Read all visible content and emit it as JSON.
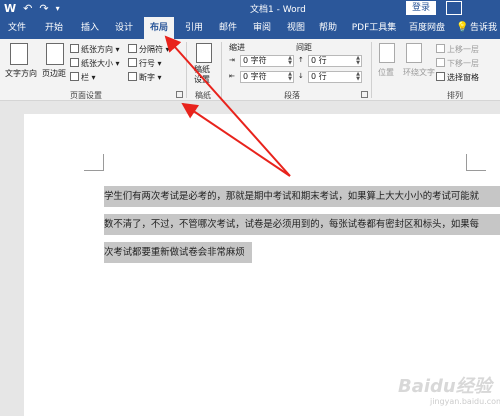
{
  "titlebar": {
    "title": "文档1 - Word",
    "login": "登录",
    "qat": [
      "W",
      "↶",
      "↷",
      "▾"
    ]
  },
  "tabs": [
    "文件",
    "开始",
    "插入",
    "设计",
    "布局",
    "引用",
    "邮件",
    "审阅",
    "视图",
    "帮助",
    "PDF工具集",
    "百度网盘",
    "操作说明搜索",
    "告诉我"
  ],
  "ribbon": {
    "text_direction": "文字方向",
    "margins": "页边距",
    "orientation": "纸张方向",
    "size": "纸张大小",
    "columns": "栏",
    "breaks": "分隔符",
    "line_numbers": "行号",
    "hyphenation": "断字",
    "group_page_setup": "页面设置",
    "manuscript": "稿纸\n设置",
    "group_manuscript": "稿纸",
    "indent": "缩进",
    "spacing": "间距",
    "indent_left": "0 字符",
    "indent_right": "0 字符",
    "space_before": "0 行",
    "space_after": "0 行",
    "group_paragraph": "段落",
    "position": "位置",
    "wrap_text": "环绕文字",
    "bring_forward": "上移一层",
    "send_backward": "下移一层",
    "selection_pane": "选择窗格",
    "group_arrange": "排列"
  },
  "document": {
    "lines": [
      "学生们有两次考试是必考的，那就是期中考试和期末考试，如果算上大大小小的考试可能就",
      "数不清了，不过，不管哪次考试，试卷是必须用到的，每张试卷都有密封区和标头，如果每",
      "次考试都要重新做试卷会非常麻烦"
    ]
  },
  "watermark": {
    "main": "Baidu经验",
    "sub": "jingyan.baidu.com"
  },
  "colors": {
    "brand": "#2b579a",
    "arrow": "#e8231c",
    "selection": "#c6c6c6"
  }
}
